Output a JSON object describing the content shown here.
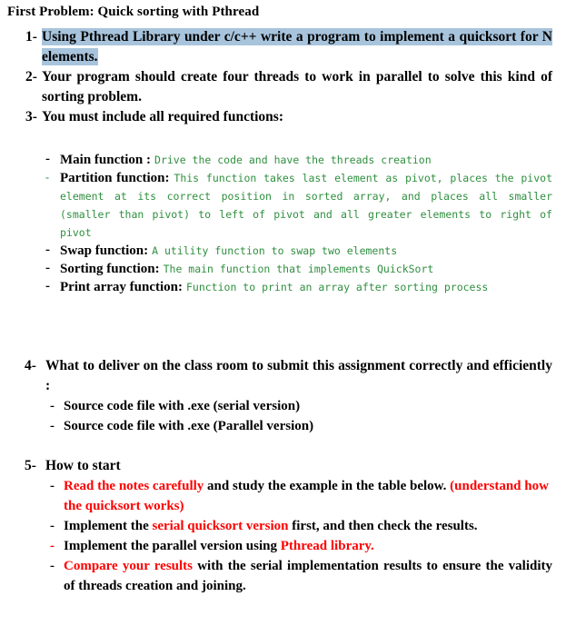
{
  "document": {
    "title": "First Problem: Quick sorting with Pthread",
    "colors": {
      "highlight": "#a8c4dc",
      "code_green": "#2f8f3f",
      "emphasis_red": "#ff0000",
      "body_black": "#000000"
    }
  },
  "items": {
    "item1": {
      "marker": "1-",
      "text": "Using Pthread Library under c/c++ write a program to implement a quicksort for N elements."
    },
    "item2": {
      "marker": "2-",
      "text": "Your program should create four threads to work in parallel to solve this kind of sorting problem."
    },
    "item3": {
      "marker": "3-",
      "text": "You must include all required functions:"
    },
    "item4": {
      "marker": "4-",
      "text": "What to deliver on the class room to submit this assignment correctly and efficiently :",
      "sub": [
        {
          "dash": "-",
          "text": "Source code file with .exe  (serial version)"
        },
        {
          "dash": "-",
          "text": "Source code file with .exe  (Parallel version)"
        }
      ]
    },
    "item5": {
      "marker": "5-",
      "text": "How to start"
    }
  },
  "functions": [
    {
      "dash": "-",
      "dash_color": "black",
      "label": "Main function :",
      "description": "Drive the code and have the threads creation",
      "justify": false
    },
    {
      "dash": "-",
      "dash_color": "green",
      "label": "Partition function:",
      "description": "This function takes last element as pivot, places  the pivot element at its correct position in sorted array, and places all smaller (smaller than pivot) to left of pivot and all greater elements to right of pivot",
      "justify": true
    },
    {
      "dash": "-",
      "dash_color": "black",
      "label": "Swap function:",
      "description": "A utility function to swap two elements",
      "justify": false
    },
    {
      "dash": "-",
      "dash_color": "black",
      "label": " Sorting function:",
      "description": "The main function that implements QuickSort",
      "justify": false
    },
    {
      "dash": "-",
      "dash_color": "black",
      "label": "Print array function:",
      "description": "Function to print an array after sorting process",
      "justify": true
    }
  ],
  "start_steps": [
    {
      "dash": "-",
      "dash_color": "black",
      "parts": [
        {
          "text": "Read the notes carefully",
          "color": "red"
        },
        {
          "text": " and study the example in the table below. ",
          "color": "black"
        },
        {
          "text": "(understand how the quicksort works)",
          "color": "red"
        }
      ],
      "justify": false
    },
    {
      "dash": "-",
      "dash_color": "black",
      "parts": [
        {
          "text": "Implement the ",
          "color": "black"
        },
        {
          "text": "serial quicksort version",
          "color": "red"
        },
        {
          "text": " first, and then check the results.",
          "color": "black"
        }
      ],
      "justify": true
    },
    {
      "dash": "-",
      "dash_color": "red",
      "parts": [
        {
          "text": "Implement the parallel version using ",
          "color": "black"
        },
        {
          "text": "Pthread library.",
          "color": "red"
        }
      ],
      "justify": false
    },
    {
      "dash": "-",
      "dash_color": "black",
      "parts": [
        {
          "text": "Compare your results",
          "color": "red"
        },
        {
          "text": " with the serial implementation results to ensure the validity of threads creation and joining.",
          "color": "black"
        }
      ],
      "justify": true
    }
  ]
}
